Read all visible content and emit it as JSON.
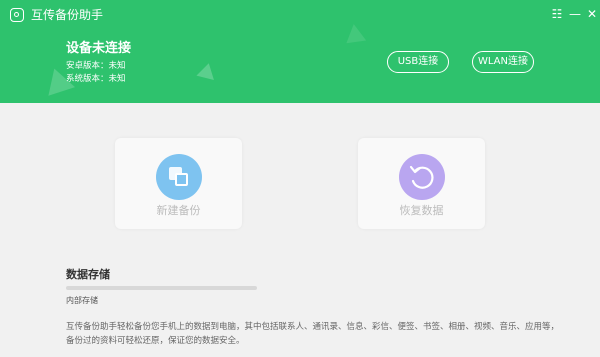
{
  "app": {
    "title": "互传备份助手",
    "icons": {
      "logo": "app-logo-icon",
      "menu": "menu-icon",
      "minimize": "minimize-icon",
      "close": "close-icon"
    },
    "menu_glyph": "☷",
    "minimize_glyph": "—",
    "close_glyph": "✕",
    "accent_color": "#2ec26d"
  },
  "device": {
    "status": "设备未连接",
    "android_version": "安卓版本：未知",
    "system_version": "系统版本：未知"
  },
  "connect": {
    "usb_label": "USB连接",
    "wlan_label": "WLAN连接"
  },
  "actions": {
    "backup": {
      "label": "新建备份",
      "icon": "backup-icon",
      "color": "#7ec3f0"
    },
    "restore": {
      "label": "恢复数据",
      "icon": "restore-icon",
      "color": "#b9a6f0"
    }
  },
  "storage": {
    "title": "数据存储",
    "internal_label": "内部存储",
    "used_fraction": 0
  },
  "description": "互传备份助手轻松备份您手机上的数据到电脑，其中包括联系人、通讯录、信息、彩信、便签、书签、相册、视频、音乐、应用等，备份过的资料可轻松还原，保证您的数据安全。"
}
